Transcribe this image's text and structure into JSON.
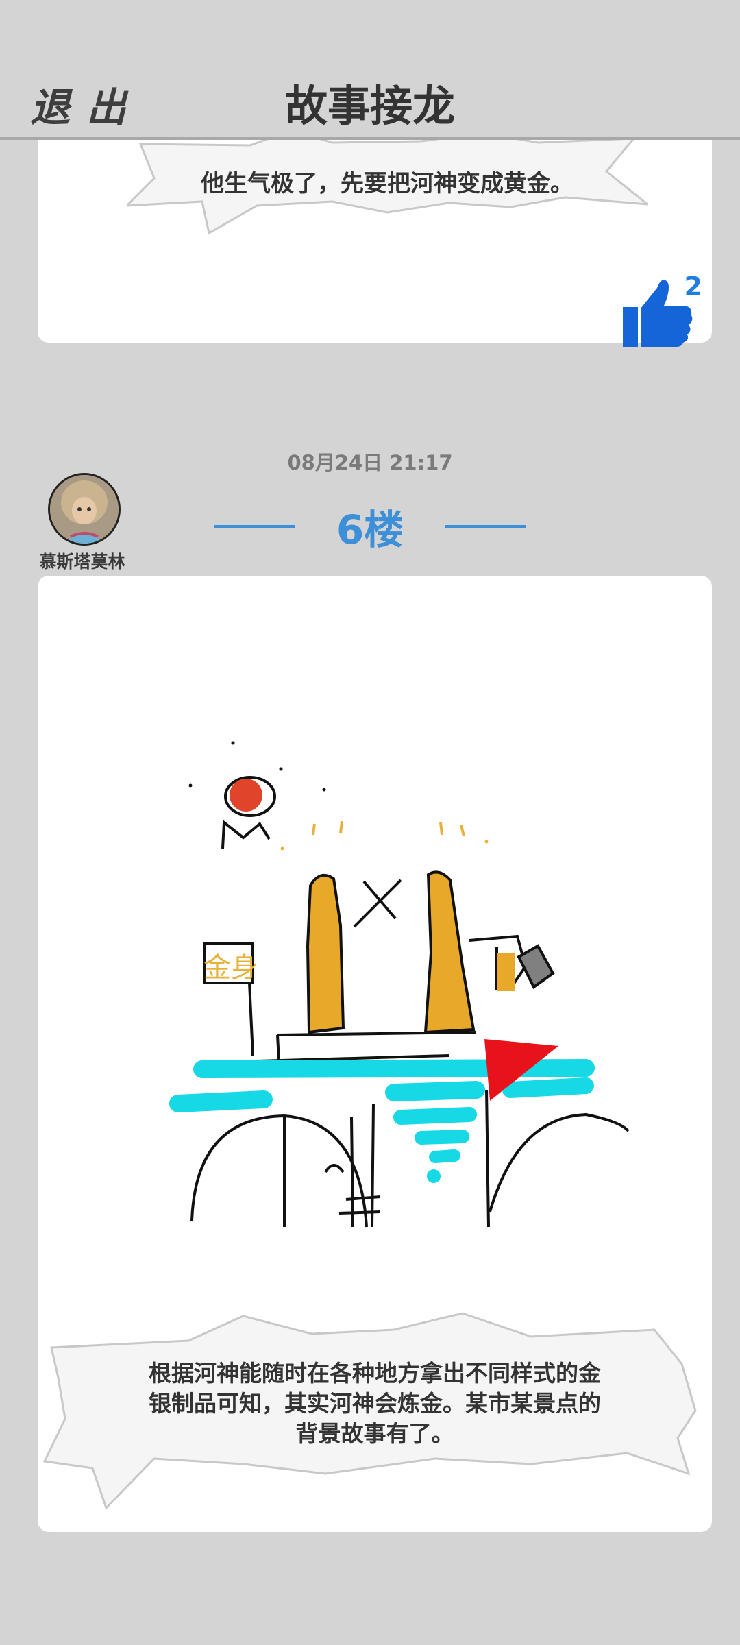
{
  "header": {
    "exit_label": "退出",
    "title": "故事接龙"
  },
  "prev_post": {
    "caption": "他生气极了，先要把河神变成黄金。",
    "like_count": "2"
  },
  "post": {
    "timestamp": "08月24日  21:17",
    "floor": "6楼",
    "username": "慕斯塔莫林",
    "drawing_text": "金身",
    "caption_lines": [
      "根据河神能随时在各种地方拿出不同样式的金",
      "银制品可知，其实河神会炼金。某市某景点的",
      "背景故事有了。"
    ]
  },
  "colors": {
    "accent": "#3d8fd8",
    "like": "#1565d8",
    "background": "#d4d4d4"
  },
  "icons": {
    "like": "thumbs-up-icon",
    "avatar": "avatar"
  }
}
